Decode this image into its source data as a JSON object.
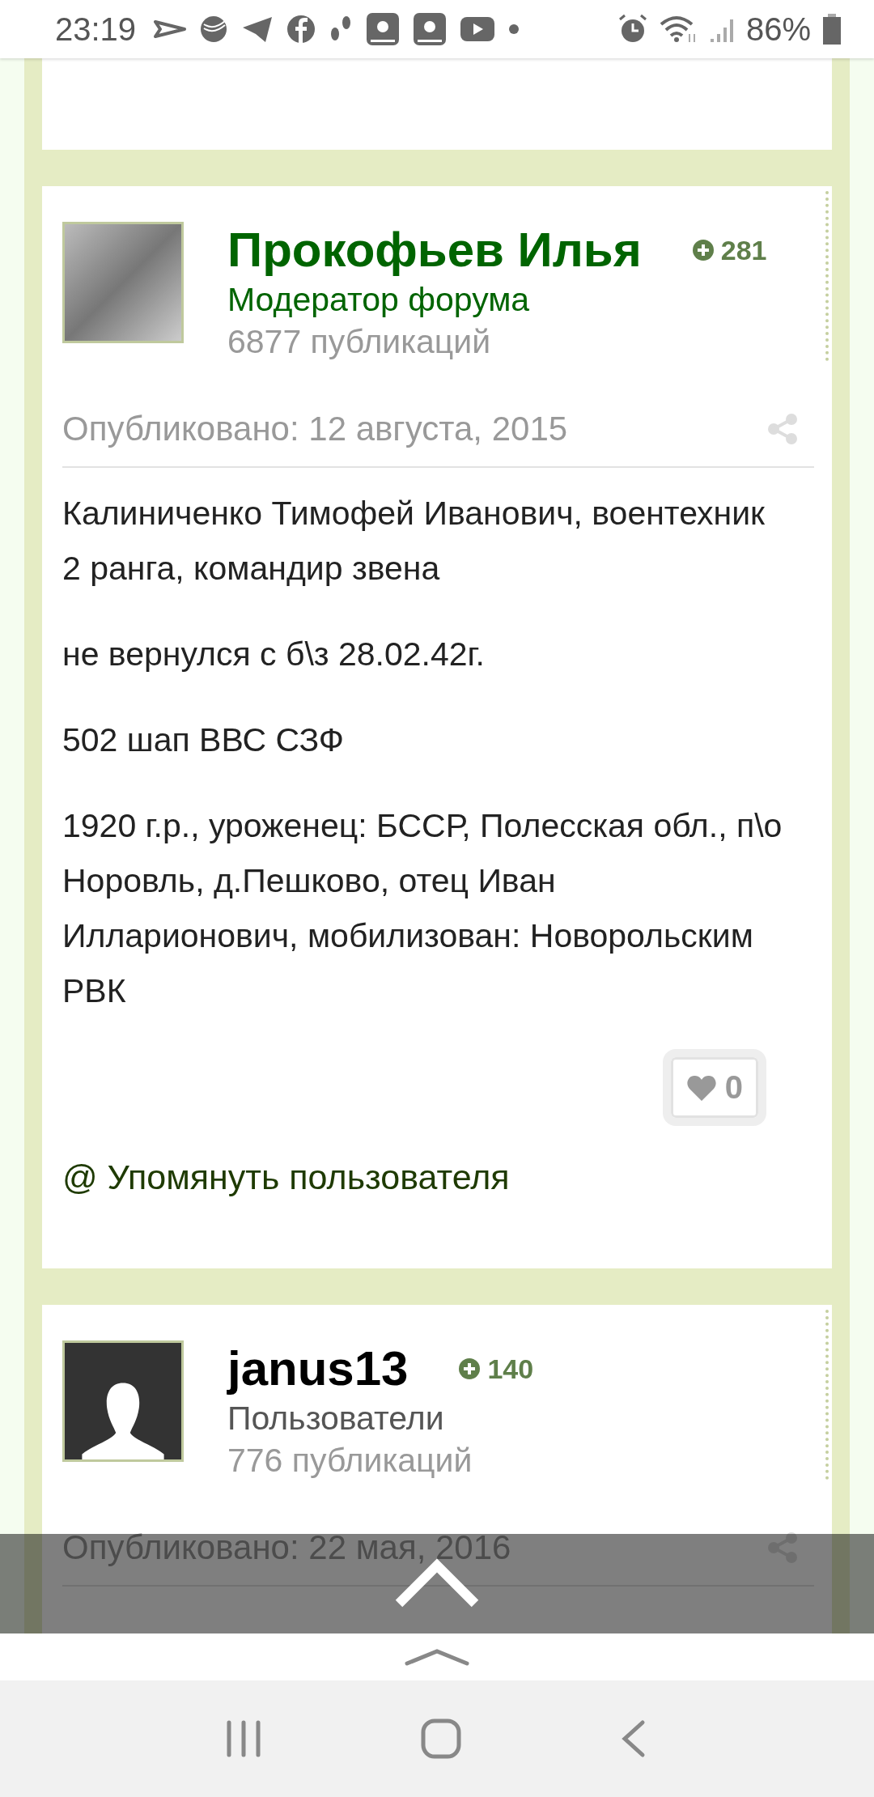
{
  "status_bar": {
    "time": "23:19",
    "battery": "86%"
  },
  "posts": [
    {
      "kind": "tail"
    },
    {
      "kind": "full",
      "author": {
        "name": "Прокофьев Илья",
        "kind": "moderator",
        "reputation": "281",
        "role": "Модератор форума",
        "posts_count": "6877 публикаций"
      },
      "published": "Опубликовано: 12 августа, 2015",
      "body": [
        "Калиниченко Тимофей Иванович, воентехник 2 ранга, командир звена",
        "не вернулся с б\\з 28.02.42г.",
        "502 шап ВВС СЗФ",
        "1920 г.р., уроженец: БССР, Полесская обл., п\\о Норовль, д.Пешково, отец Иван Илларионович, мобилизован: Новорольским РВК"
      ],
      "likes": "0",
      "mention": "@ Упомянуть пользователя"
    },
    {
      "kind": "head",
      "author": {
        "name": "janus13",
        "kind": "member",
        "reputation": "140",
        "role": "Пользователи",
        "posts_count": "776 публикаций"
      },
      "published": "Опубликовано: 22 мая, 2016"
    }
  ]
}
